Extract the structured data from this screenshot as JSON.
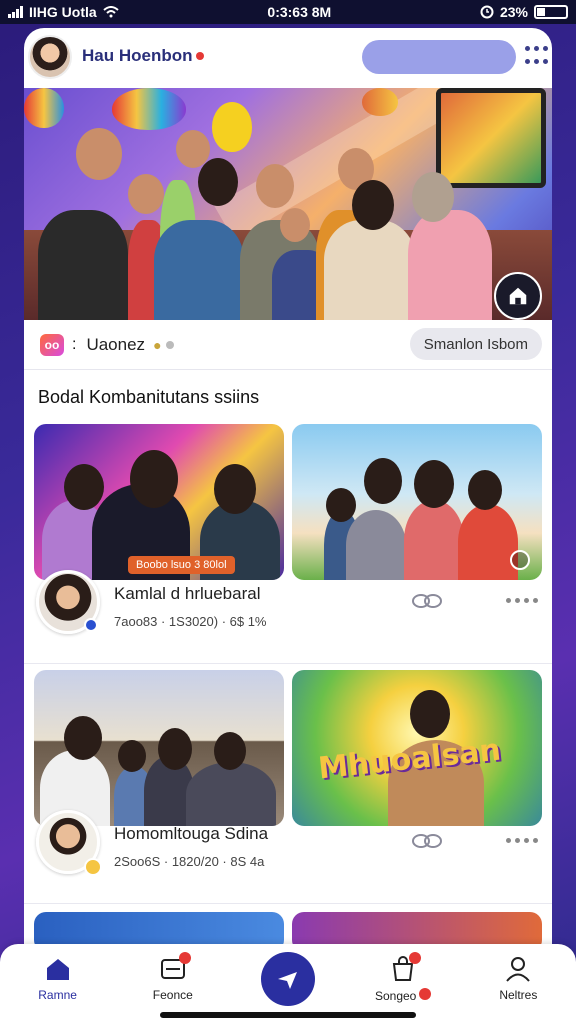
{
  "status_bar": {
    "carrier": "IIHG Uotla",
    "time": "0:3:63 8M",
    "battery_text": "23%",
    "icons": [
      "signal-icon",
      "wifi-icon",
      "alarm-icon",
      "battery-icon"
    ]
  },
  "header": {
    "brand_title": "Hau Hoenbon",
    "brand_subtitle": "",
    "icons": [
      "avatar",
      "kebab-menu-icon"
    ]
  },
  "hero": {
    "icons": [
      "home-icon"
    ]
  },
  "info_row": {
    "chip_symbol": "oo",
    "name": "Uaonez",
    "button_label": "Smanlon Isbom"
  },
  "section": {
    "title": "Bodal Kombanitutans ssiins"
  },
  "posts": [
    {
      "left_image_caption": "Boobo lsuo 3 80lol",
      "right_image_text": "",
      "title": "Kamlal d hrluebaral",
      "stats": "7aoo83 · 1S3020) · 6$ 1%",
      "link_icon": "link-icon"
    },
    {
      "left_image_caption": "",
      "right_image_text": "Mhuoalsan",
      "title": "Homomltouga Sdina",
      "stats": "2Soo6S · 1820/20 · 8S 4a",
      "link_icon": "link-icon"
    }
  ],
  "bottom_nav": {
    "items": [
      {
        "label": "Ramne",
        "icon": "home-icon"
      },
      {
        "label": "Feonce",
        "icon": "feed-icon"
      },
      {
        "label": "",
        "icon": "send-icon"
      },
      {
        "label": "Songeo",
        "icon": "bag-icon"
      },
      {
        "label": "Neltres",
        "icon": "profile-icon"
      }
    ]
  },
  "colors": {
    "accent": "#2a2fa0",
    "badge": "#e53935",
    "background": "#3a2a9a"
  }
}
